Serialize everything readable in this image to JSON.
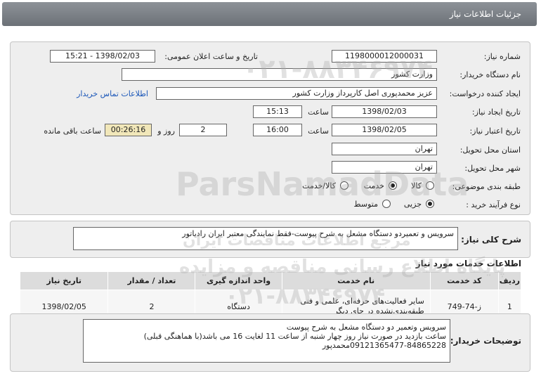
{
  "window": {
    "title": "جزئیات اطلاعات نیاز"
  },
  "form": {
    "need_number": {
      "label": "شماره نیاز:",
      "value": "1198000012000031"
    },
    "announce": {
      "label": "تاریخ و ساعت اعلان عمومی:",
      "value": "1398/02/03 - 15:21"
    },
    "buyer_org": {
      "label": "نام دستگاه خریدار:",
      "value": "وزارت کشور"
    },
    "requester": {
      "label": "ایجاد کننده درخواست:",
      "value": "عزیز محمدپوری اصل کارپرداز وزارت کشور",
      "contact_link": "اطلاعات تماس خریدار"
    },
    "created": {
      "label": "تاریخ ایجاد نیاز:",
      "date": "1398/02/03",
      "time_label": "ساعت",
      "time": "15:13"
    },
    "validity": {
      "label": "تاریخ اعتبار نیاز:",
      "date": "1398/02/05",
      "time_label": "ساعت",
      "time": "16:00",
      "days": "2",
      "days_label": "روز و",
      "remaining": "00:26:16",
      "remaining_label": "ساعت باقی مانده"
    },
    "province": {
      "label": "استان محل تحویل:",
      "value": "تهران"
    },
    "city": {
      "label": "شهر محل تحویل:",
      "value": "تهران"
    },
    "category": {
      "label": "طبقه بندی موضوعی:",
      "options": [
        "کالا",
        "خدمت",
        "کالا/خدمت"
      ],
      "selected": "خدمت"
    },
    "process": {
      "label": "نوع فرآیند خرید :",
      "options": [
        "جزیی",
        "متوسط"
      ],
      "selected": "جزیی"
    }
  },
  "summary": {
    "label": "شرح کلی نیاز:",
    "value": "سرویس و تعمیردو دستگاه مشعل به شرح پیوست-فقط نمایندگی معتبر ایران رادیاتور"
  },
  "services": {
    "title": "اطلاعات خدمات مورد نیاز",
    "columns": [
      "ردیف",
      "کد خدمت",
      "نام خدمت",
      "واحد اندازه گیری",
      "تعداد / مقدار",
      "تاریخ نیاز"
    ],
    "rows": [
      {
        "index": "1",
        "code": "ز-74-749",
        "name": "سایر فعالیت‌های حرفه‌ای، علمی و فنی طبقه‌بندی‌نشده در جای دیگر",
        "unit": "دستگاه",
        "qty": "2",
        "date": "1398/02/05"
      }
    ]
  },
  "buyer_notes": {
    "label": "توضیحات خریدار:",
    "lines": [
      "سرویس وتعمیر دو دستگاه مشعل به شرح پیوست",
      "ساعت بازدید در صورت نیاز روز چهار شنبه از ساعت 11 لغایت 16 می باشد(با هماهنگی قبلی)",
      "09121365477-84865228محمدپور"
    ]
  },
  "watermark": {
    "brand": "ParsNamadData",
    "tagline": "پایگاه اطلاع رسانی مناقصه و مزایده",
    "phone": "۰۲۱-۸۸۳۴۶۹۷۴",
    "extra": "مرجع اطلاعات مناقصات ایران"
  }
}
